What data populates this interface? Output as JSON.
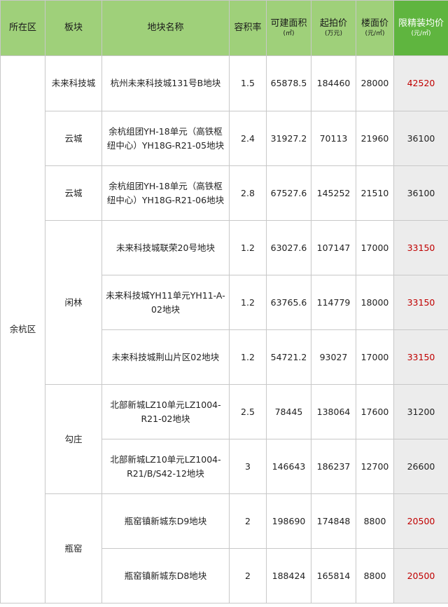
{
  "headers": {
    "district": "所在区",
    "block": "板块",
    "plot_name": "地块名称",
    "far": "容积率",
    "area": "可建面积",
    "area_unit": "(㎡)",
    "start_price": "起拍价",
    "start_price_unit": "(万元)",
    "floor_price": "楼面价",
    "floor_price_unit": "(元/㎡)",
    "limit_price": "限精装均价",
    "limit_price_unit": "(元/㎡)"
  },
  "district": "余杭区",
  "blocks": [
    "未来科技城",
    "云城",
    "云城",
    "闲林",
    "勾庄",
    "瓶窑"
  ],
  "rows": [
    {
      "name": "杭州未来科技城131号B地块",
      "far": "1.5",
      "area": "65878.5",
      "start": "184460",
      "floor": "28000",
      "limit": "42520"
    },
    {
      "name": "余杭组团YH-18单元（高铁枢纽中心）YH18G-R21-05地块",
      "far": "2.4",
      "area": "31927.2",
      "start": "70113",
      "floor": "21960",
      "limit": "36100"
    },
    {
      "name": "余杭组团YH-18单元（高铁枢纽中心）YH18G-R21-06地块",
      "far": "2.8",
      "area": "67527.6",
      "start": "145252",
      "floor": "21510",
      "limit": "36100"
    },
    {
      "name": "未来科技城联荣20号地块",
      "far": "1.2",
      "area": "63027.6",
      "start": "107147",
      "floor": "17000",
      "limit": "33150"
    },
    {
      "name": "未来科技城YH11单元YH11-A-02地块",
      "far": "1.2",
      "area": "63765.6",
      "start": "114779",
      "floor": "18000",
      "limit": "33150"
    },
    {
      "name": "未来科技城荆山片区02地块",
      "far": "1.2",
      "area": "54721.2",
      "start": "93027",
      "floor": "17000",
      "limit": "33150"
    },
    {
      "name": "北部新城LZ10单元LZ1004-R21-02地块",
      "far": "2.5",
      "area": "78445",
      "start": "138064",
      "floor": "17600",
      "limit": "31200"
    },
    {
      "name": "北部新城LZ10单元LZ1004-R21/B/S42-12地块",
      "far": "3",
      "area": "146643",
      "start": "186237",
      "floor": "12700",
      "limit": "26600"
    },
    {
      "name": "瓶窑镇新城东D9地块",
      "far": "2",
      "area": "198690",
      "start": "174848",
      "floor": "8800",
      "limit": "20500"
    },
    {
      "name": "瓶窑镇新城东D8地块",
      "far": "2",
      "area": "188424",
      "start": "165814",
      "floor": "8800",
      "limit": "20500"
    }
  ],
  "colors": {
    "header_bg": "#9fd07a",
    "header_highlight_bg": "#5fb53f",
    "highlight_text": "#c00000",
    "limit_col_bg": "#ececec"
  }
}
